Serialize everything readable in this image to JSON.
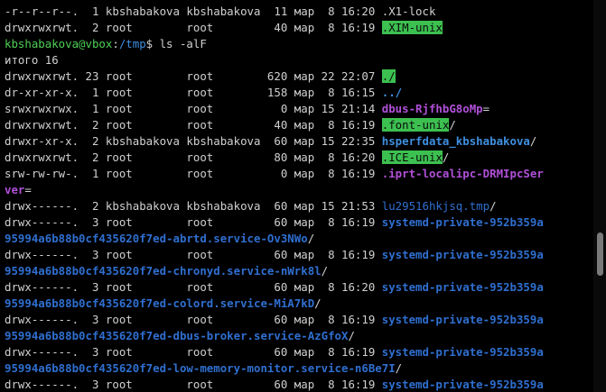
{
  "terminal": {
    "lines": [
      [
        {
          "t": "-r--r--r--.  1 kbshabakova kbshabakova  11 мар  8 16:20 ",
          "c": "c-gray"
        },
        {
          "t": ".X1-lock",
          "c": "c-gray"
        }
      ],
      [
        {
          "t": "drwxrwxrwt.  2 root        root         40 мар  8 16:19 ",
          "c": "c-gray"
        },
        {
          "t": ".XIM-unix",
          "c": "hl"
        }
      ],
      [
        {
          "t": "kbshabakova@vbox",
          "c": "c-green"
        },
        {
          "t": ":",
          "c": "c-gray"
        },
        {
          "t": "/tmp",
          "c": "c-blue"
        },
        {
          "t": "$ ls -alF",
          "c": "c-gray"
        }
      ],
      [
        {
          "t": "итого 16",
          "c": "c-gray"
        }
      ],
      [
        {
          "t": "drwxrwxrwt. 23 root        root        620 мар 22 22:07 ",
          "c": "c-gray"
        },
        {
          "t": "./",
          "c": "hl"
        }
      ],
      [
        {
          "t": "dr-xr-xr-x.  1 root        root        158 мар  8 16:15 ",
          "c": "c-gray"
        },
        {
          "t": "../",
          "c": "c-blue bold"
        }
      ],
      [
        {
          "t": "srwxrwxrwx.  1 root        root          0 мар 15 21:14 ",
          "c": "c-gray"
        },
        {
          "t": "dbus-RjfhbG8oMp",
          "c": "c-purple bold"
        },
        {
          "t": "=",
          "c": "c-gray"
        }
      ],
      [
        {
          "t": "drwxrwxrwt.  2 root        root         40 мар  8 16:19 ",
          "c": "c-gray"
        },
        {
          "t": ".font-unix",
          "c": "hl"
        },
        {
          "t": "/",
          "c": "c-gray"
        }
      ],
      [
        {
          "t": "drwxr-xr-x.  2 kbshabakova kbshabakova  60 мар 15 22:35 ",
          "c": "c-gray"
        },
        {
          "t": "hsperfdata_kbshabakova",
          "c": "c-blue bold"
        },
        {
          "t": "/",
          "c": "c-gray"
        }
      ],
      [
        {
          "t": "drwxrwxrwt.  2 root        root         80 мар  8 16:20 ",
          "c": "c-gray"
        },
        {
          "t": ".ICE-unix",
          "c": "hl"
        },
        {
          "t": "/",
          "c": "c-gray"
        }
      ],
      [
        {
          "t": "srw-rw-rw-.  1 root        root          0 мар  8 16:19 ",
          "c": "c-gray"
        },
        {
          "t": ".iprt-localipc-DRMIpcSer",
          "c": "c-purple bold"
        }
      ],
      [
        {
          "t": "ver",
          "c": "c-purple bold"
        },
        {
          "t": "=",
          "c": "c-gray"
        }
      ],
      [
        {
          "t": "drwx------.  2 kbshabakova kbshabakova  60 мар 15 21:53 ",
          "c": "c-gray"
        },
        {
          "t": "lu29516hkjsq.tmp",
          "c": "c-dblue"
        },
        {
          "t": "/",
          "c": "c-gray"
        }
      ],
      [
        {
          "t": "drwx------.  3 root        root         60 мар  8 16:19 ",
          "c": "c-gray"
        },
        {
          "t": "systemd-private-952b359a",
          "c": "c-dblue bold"
        }
      ],
      [
        {
          "t": "95994a6b88b0cf435620f7ed-abrtd.service-Ov3NWo",
          "c": "c-dblue bold"
        },
        {
          "t": "/",
          "c": "c-gray"
        }
      ],
      [
        {
          "t": "drwx------.  3 root        root         60 мар  8 16:19 ",
          "c": "c-gray"
        },
        {
          "t": "systemd-private-952b359a",
          "c": "c-dblue bold"
        }
      ],
      [
        {
          "t": "95994a6b88b0cf435620f7ed-chronyd.service-nWrk8l",
          "c": "c-dblue bold"
        },
        {
          "t": "/",
          "c": "c-gray"
        }
      ],
      [
        {
          "t": "drwx------.  3 root        root         60 мар  8 16:20 ",
          "c": "c-gray"
        },
        {
          "t": "systemd-private-952b359a",
          "c": "c-dblue bold"
        }
      ],
      [
        {
          "t": "95994a6b88b0cf435620f7ed-colord.service-MiA7kD",
          "c": "c-dblue bold"
        },
        {
          "t": "/",
          "c": "c-gray"
        }
      ],
      [
        {
          "t": "drwx------.  3 root        root         60 мар  8 16:19 ",
          "c": "c-gray"
        },
        {
          "t": "systemd-private-952b359a",
          "c": "c-dblue bold"
        }
      ],
      [
        {
          "t": "95994a6b88b0cf435620f7ed-dbus-broker.service-AzGfoX",
          "c": "c-dblue bold"
        },
        {
          "t": "/",
          "c": "c-gray"
        }
      ],
      [
        {
          "t": "drwx------.  3 root        root         60 мар  8 16:19 ",
          "c": "c-gray"
        },
        {
          "t": "systemd-private-952b359a",
          "c": "c-dblue bold"
        }
      ],
      [
        {
          "t": "95994a6b88b0cf435620f7ed-low-memory-monitor.service-n6Be7I",
          "c": "c-dblue bold"
        },
        {
          "t": "/",
          "c": "c-gray"
        }
      ],
      [
        {
          "t": "drwx------.  3 root        root         60 мар  8 16:19 ",
          "c": "c-gray"
        },
        {
          "t": "systemd-private-952b359a",
          "c": "c-dblue bold"
        }
      ]
    ]
  }
}
